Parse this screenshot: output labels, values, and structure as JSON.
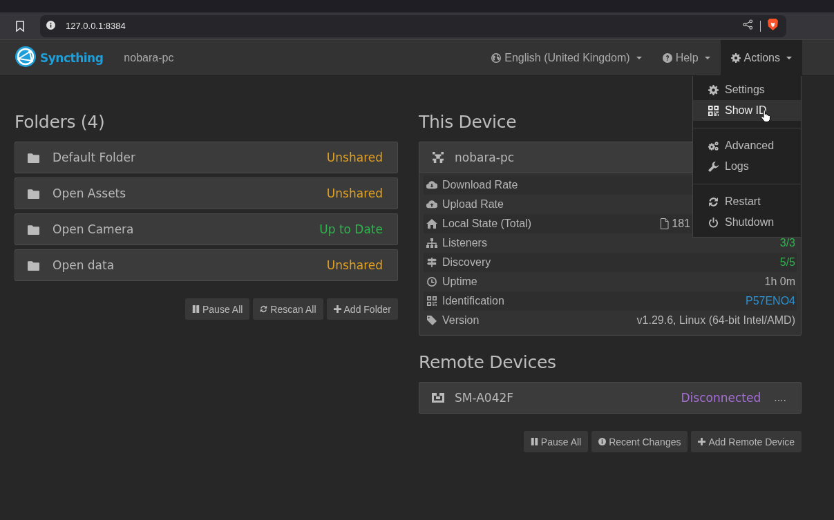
{
  "browser": {
    "url": "127.0.0.1:8384"
  },
  "navbar": {
    "brand": "Syncthing",
    "device_name": "nobara-pc",
    "menus": [
      {
        "kind": "language",
        "label": "English (United Kingdom)",
        "open": false
      },
      {
        "kind": "help",
        "label": "Help",
        "open": false
      },
      {
        "kind": "actions",
        "label": "Actions",
        "open": true
      }
    ]
  },
  "actions_menu": {
    "groups": [
      [
        {
          "kind": "settings",
          "label": "Settings",
          "highlighted": false
        },
        {
          "kind": "qr",
          "label": "Show ID",
          "highlighted": true
        }
      ],
      [
        {
          "kind": "cogs",
          "label": "Advanced",
          "highlighted": false
        },
        {
          "kind": "wrench",
          "label": "Logs",
          "highlighted": false
        }
      ],
      [
        {
          "kind": "restart",
          "label": "Restart",
          "highlighted": false
        },
        {
          "kind": "power",
          "label": "Shutdown",
          "highlighted": false
        }
      ]
    ]
  },
  "folders": {
    "title": "Folders (4)",
    "items": [
      {
        "name": "Default Folder",
        "status": "Unshared",
        "color": "#e4a11b"
      },
      {
        "name": "Open Assets",
        "status": "Unshared",
        "color": "#e4a11b"
      },
      {
        "name": "Open Camera",
        "status": "Up to Date",
        "color": "#2fb44d"
      },
      {
        "name": "Open data",
        "status": "Unshared",
        "color": "#e4a11b"
      }
    ],
    "buttons": [
      {
        "kind": "pause",
        "label": "Pause All"
      },
      {
        "kind": "rescan",
        "label": "Rescan All"
      },
      {
        "kind": "add",
        "label": "Add Folder"
      }
    ]
  },
  "this_device": {
    "title": "This Device",
    "name": "nobara-pc",
    "stats": [
      {
        "kind": "download",
        "label": "Download Rate"
      },
      {
        "kind": "upload",
        "label": "Upload Rate"
      },
      {
        "kind": "home",
        "label": "Local State (Total)",
        "value": "181"
      },
      {
        "kind": "sitemap",
        "label": "Listeners",
        "value": "3/3",
        "color": "#2fb44d"
      },
      {
        "kind": "signpost",
        "label": "Discovery",
        "value": "5/5",
        "color": "#2fb44d"
      },
      {
        "kind": "clock",
        "label": "Uptime",
        "value": "1h 0m"
      },
      {
        "kind": "qr",
        "label": "Identification",
        "value": "P57ENO4",
        "color": "#2a93d5"
      },
      {
        "kind": "tag",
        "label": "Version",
        "value": "v1.29.6, Linux (64-bit Intel/AMD)"
      }
    ]
  },
  "remote_devices": {
    "title": "Remote Devices",
    "items": [
      {
        "name": "SM-A042F",
        "status": "Disconnected",
        "color": "#a66fd6",
        "extra": "...."
      }
    ],
    "buttons": [
      {
        "kind": "pause",
        "label": "Pause All"
      },
      {
        "kind": "info",
        "label": "Recent Changes"
      },
      {
        "kind": "add",
        "label": "Add Remote Device"
      }
    ]
  }
}
